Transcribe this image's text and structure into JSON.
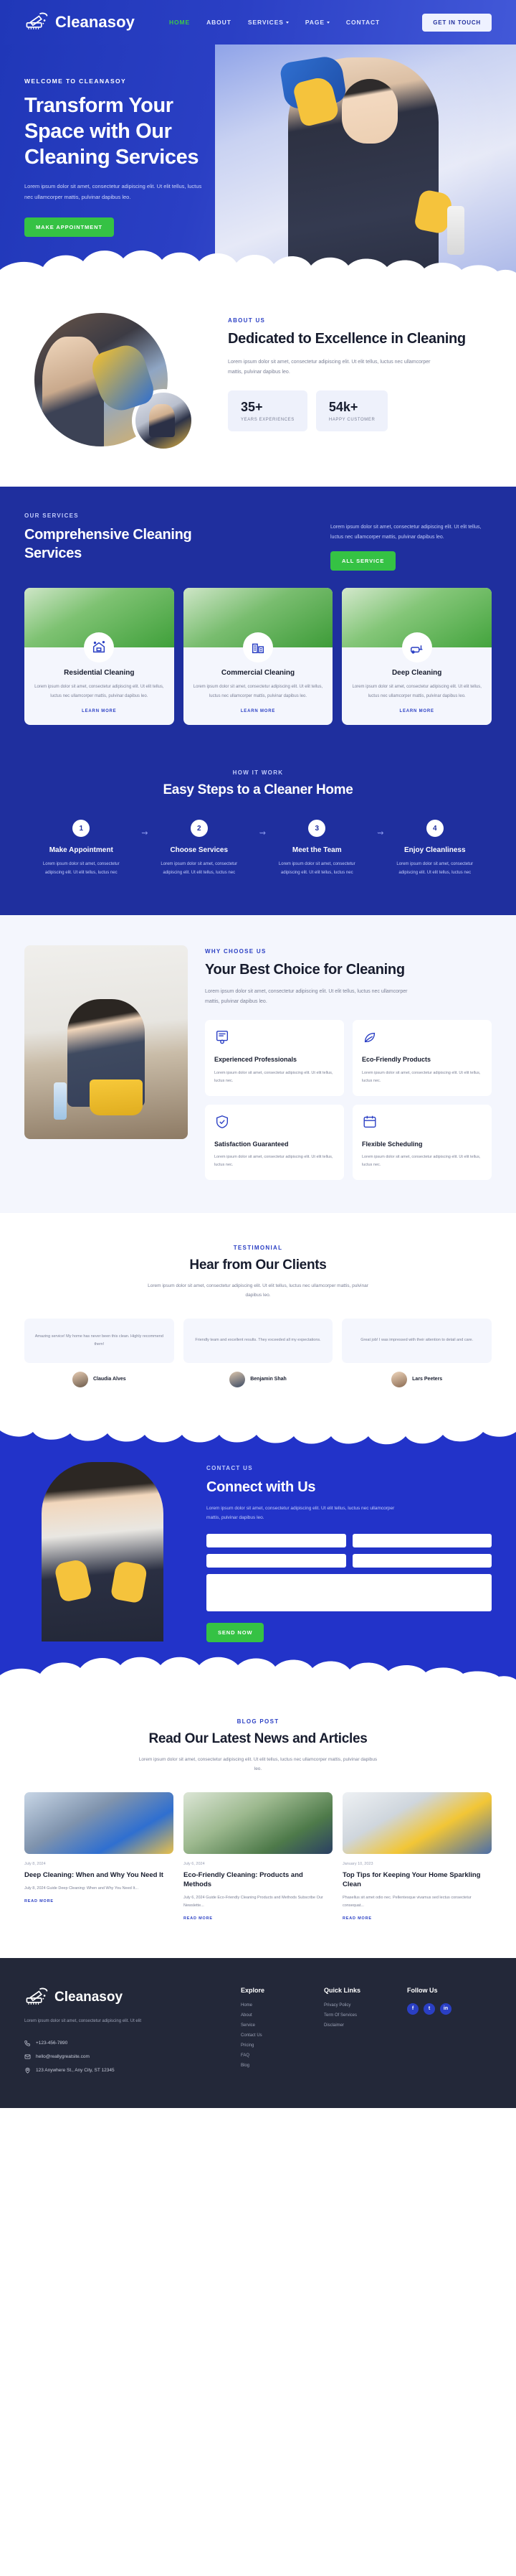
{
  "brand": {
    "name": "Cleanasoy",
    "logo_icon": "brush-icon"
  },
  "header": {
    "nav": [
      {
        "label": "HOME",
        "active": true,
        "caret": false
      },
      {
        "label": "ABOUT",
        "active": false,
        "caret": false
      },
      {
        "label": "SERVICES",
        "active": false,
        "caret": true
      },
      {
        "label": "PAGE",
        "active": false,
        "caret": true
      },
      {
        "label": "CONTACT",
        "active": false,
        "caret": false
      }
    ],
    "cta": "GET IN TOUCH"
  },
  "hero": {
    "eyebrow": "WELCOME TO CLEANASOY",
    "title": "Transform Your Space with Our Cleaning Services",
    "subtitle": "Lorem ipsum dolor sit amet, consectetur adipiscing elit. Ut elit tellus, luctus nec ullamcorper mattis, pulvinar dapibus leo.",
    "cta": "MAKE APPOINTMENT"
  },
  "about": {
    "label": "ABOUT US",
    "title": "Dedicated to Excellence in Cleaning",
    "text": "Lorem ipsum dolor sit amet, consectetur adipiscing elit. Ut elit tellus, luctus nec ullamcorper mattis, pulvinar dapibus leo.",
    "stats": [
      {
        "number": "35+",
        "label": "YEARS EXPERIENCES"
      },
      {
        "number": "54k+",
        "label": "HAPPY CUSTOMER"
      }
    ]
  },
  "services": {
    "label": "OUR SERVICES",
    "title": "Comprehensive Cleaning Services",
    "side_text": "Lorem ipsum dolor sit amet, consectetur adipiscing elit. Ut elit tellus, luctus nec ullamcorper mattis, pulvinar dapibus leo.",
    "side_cta": "ALL SERVICE",
    "cards": [
      {
        "title": "Residential Cleaning",
        "text": "Lorem ipsum dolor sit amet, consectetur adipiscing elit. Ut elit tellus, luctus nec ullamcorper mattis, pulvinar dapibus leo.",
        "link": "LEARN MORE",
        "icon": "home-sparkle-icon"
      },
      {
        "title": "Commercial Cleaning",
        "text": "Lorem ipsum dolor sit amet, consectetur adipiscing elit. Ut elit tellus, luctus nec ullamcorper mattis, pulvinar dapibus leo.",
        "link": "LEARN MORE",
        "icon": "building-icon"
      },
      {
        "title": "Deep Cleaning",
        "text": "Lorem ipsum dolor sit amet, consectetur adipiscing elit. Ut elit tellus, luctus nec ullamcorper mattis, pulvinar dapibus leo.",
        "link": "LEARN MORE",
        "icon": "vacuum-icon"
      }
    ]
  },
  "steps": {
    "label": "HOW IT WORK",
    "title": "Easy Steps to a Cleaner Home",
    "items": [
      {
        "num": "1",
        "title": "Make Appointment",
        "text": "Lorem ipsum dolor sit amet, consectetur adipiscing elit. Ut elit tellus, luctus nec"
      },
      {
        "num": "2",
        "title": "Choose Services",
        "text": "Lorem ipsum dolor sit amet, consectetur adipiscing elit. Ut elit tellus, luctus nec"
      },
      {
        "num": "3",
        "title": "Meet the Team",
        "text": "Lorem ipsum dolor sit amet, consectetur adipiscing elit. Ut elit tellus, luctus nec"
      },
      {
        "num": "4",
        "title": "Enjoy Cleanliness",
        "text": "Lorem ipsum dolor sit amet, consectetur adipiscing elit. Ut elit tellus, luctus nec"
      }
    ]
  },
  "why": {
    "label": "WHY CHOOSE US",
    "title": "Your Best Choice for Cleaning",
    "text": "Lorem ipsum dolor sit amet, consectetur adipiscing elit. Ut elit tellus, luctus nec ullamcorper mattis, pulvinar dapibus leo.",
    "features": [
      {
        "title": "Experienced Professionals",
        "text": "Lorem ipsum dolor sit amet, consectetur adipiscing elit. Ut elit tellus, luctus nec.",
        "icon": "certificate-icon"
      },
      {
        "title": "Eco-Friendly Products",
        "text": "Lorem ipsum dolor sit amet, consectetur adipiscing elit. Ut elit tellus, luctus nec.",
        "icon": "leaf-icon"
      },
      {
        "title": "Satisfaction Guaranteed",
        "text": "Lorem ipsum dolor sit amet, consectetur adipiscing elit. Ut elit tellus, luctus nec.",
        "icon": "shield-check-icon"
      },
      {
        "title": "Flexible Scheduling",
        "text": "Lorem ipsum dolor sit amet, consectetur adipiscing elit. Ut elit tellus, luctus nec.",
        "icon": "calendar-icon"
      }
    ]
  },
  "testimonials": {
    "label": "TESTIMONIAL",
    "title": "Hear from Our Clients",
    "subtitle": "Lorem ipsum dolor sit amet, consectetur adipiscing elit. Ut elit tellus, luctus nec ullamcorper mattis, pulvinar dapibus leo.",
    "items": [
      {
        "quote": "Amazing service! My home has never been this clean. Highly recommend them!",
        "name": "Claudia Alves",
        "avatar": "avatar-claudia"
      },
      {
        "quote": "Friendly team and excellent results. They exceeded all my expectations.",
        "name": "Benjamin Shah",
        "avatar": "avatar-benjamin"
      },
      {
        "quote": "Great job! I was impressed with their attention to detail and care.",
        "name": "Lars Peeters",
        "avatar": "avatar-lars"
      }
    ]
  },
  "contact": {
    "label": "CONTACT US",
    "title": "Connect with Us",
    "text": "Lorem ipsum dolor sit amet, consectetur adipiscing elit. Ut elit tellus, luctus nec ullamcorper mattis, pulvinar dapibus leo.",
    "fields": {
      "name_placeholder": "",
      "email_placeholder": "",
      "phone_placeholder": "",
      "subject_placeholder": "",
      "message_placeholder": ""
    },
    "cta": "SEND NOW"
  },
  "blog": {
    "label": "BLOG POST",
    "title": "Read Our Latest News and Articles",
    "subtitle": "Lorem ipsum dolor sit amet, consectetur adipiscing elit. Ut elit tellus, luctus nec ullamcorper mattis, pulvinar dapibus leo.",
    "posts": [
      {
        "date": "July 8, 2024",
        "title": "Deep Cleaning: When and Why You Need It",
        "text": "July 8, 2024 Guide Deep Cleaning: When and Why You Need It...",
        "link": "READ MORE",
        "image": "post-image-deep-cleaning"
      },
      {
        "date": "July 6, 2024",
        "title": "Eco-Friendly Cleaning: Products and Methods",
        "text": "July 6, 2024 Guide Eco-Friendly Cleaning Products and Methods Subscribe Our Newslette...",
        "link": "READ MORE",
        "image": "post-image-eco-friendly"
      },
      {
        "date": "January 10, 2023",
        "title": "Top Tips for Keeping Your Home Sparkling Clean",
        "text": "Phasellus sit amet odio nec. Pellentesque vivamus sed lectus consectetur consequat...",
        "link": "READ MORE",
        "image": "post-image-top-tips"
      }
    ]
  },
  "footer": {
    "description": "Lorem ipsum dolor sit amet, consectetur adipiscing elit. Ut elit",
    "phone": "+123-456-7890",
    "email": "hello@reallygreatsite.com",
    "address": "123 Anywhere St., Any City, ST 12345",
    "columns": [
      {
        "heading": "Explore",
        "links": [
          "Home",
          "About",
          "Service",
          "Contact Us",
          "Pricing",
          "FAQ",
          "Blog"
        ]
      },
      {
        "heading": "Quick Links",
        "links": [
          "Privacy Policy",
          "Term Of Services",
          "Disclaimer"
        ]
      }
    ],
    "follow_heading": "Follow Us",
    "socials": [
      {
        "name": "facebook-icon",
        "glyph": "f"
      },
      {
        "name": "twitter-icon",
        "glyph": "t"
      },
      {
        "name": "linkedin-icon",
        "glyph": "in"
      }
    ]
  },
  "colors": {
    "brand_blue": "#2a3fc4",
    "deep_blue": "#1f2f9e",
    "green": "#35c244",
    "dark": "#232839",
    "light_bg": "#f4f6fd"
  }
}
